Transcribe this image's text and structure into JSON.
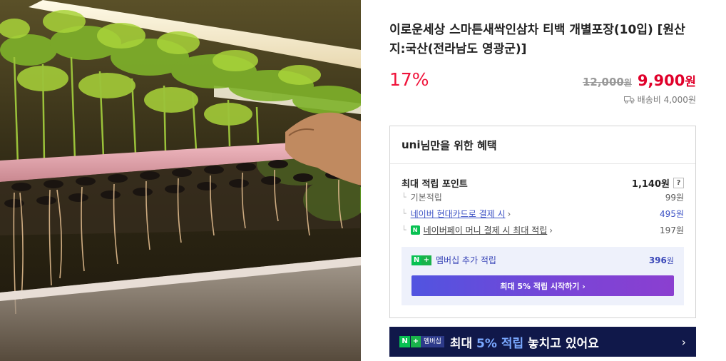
{
  "product": {
    "title": "이로운세상 스마튼새싹인삼차 티백 개별포장(10입) [원산지:국산(전라남도 영광군)]",
    "discount_rate": "17%",
    "original_price": "12,000",
    "original_unit": "원",
    "sale_price": "9,900",
    "sale_unit": "원",
    "shipping_label": "배송비 4,000원"
  },
  "benefit": {
    "user_name": "uni",
    "header_suffix": "님만을 위한 혜택",
    "max_points_label": "최대 적립 포인트",
    "max_points_value": "1,140원",
    "help_icon": "?",
    "basic_label": "기본적립",
    "basic_value": "99원",
    "card_label": "네이버 현대카드로 결제 시",
    "card_value": "495원",
    "npay_label": "네이버페이 머니 결제 시 최대 적립",
    "npay_value": "197원",
    "member_label": "멤버십 추가 적립",
    "member_value": "396",
    "member_unit": "원",
    "cta_label": "최대 5% 적립 시작하기 ›"
  },
  "banner": {
    "badge_n": "N",
    "badge_plus": "+",
    "badge_membership": "멤버십",
    "text_before": "최대 ",
    "text_highlight": "5% 적립",
    "text_after": " 놓치고 있어요",
    "arrow": "›"
  },
  "colors": {
    "discount": "#f0133a",
    "sale_price": "#e0002a",
    "link_blue": "#3a50c4",
    "member_bg": "#eef1fb",
    "banner_bg": "#10184a",
    "naver_green": "#08c152"
  },
  "icons": {
    "truck": "truck-icon",
    "chevron": "chevron-right-icon",
    "npay": "npay-icon",
    "nplus": "naver-plus-icon"
  }
}
